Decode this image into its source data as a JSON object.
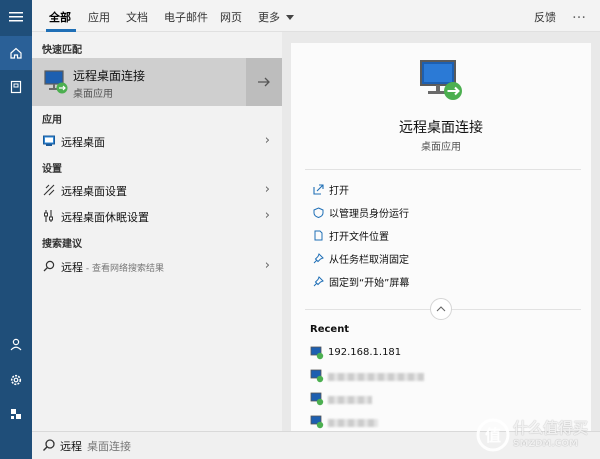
{
  "tabs": [
    "全部",
    "应用",
    "文档",
    "电子邮件",
    "网页",
    "更多"
  ],
  "topbar": {
    "feedback": "反馈",
    "more_icon_label": "…"
  },
  "left": {
    "best_match_section": "快速匹配",
    "best_match": {
      "title": "远程桌面连接",
      "subtitle": "桌面应用"
    },
    "apps_section": "应用",
    "apps": [
      {
        "label": "远程桌面"
      }
    ],
    "settings_section": "设置",
    "settings": [
      {
        "label": "远程桌面设置"
      },
      {
        "label": "远程桌面休眠设置"
      }
    ],
    "suggestions_section": "搜索建议",
    "suggestions": [
      {
        "label": "远程",
        "hint": " - 查看网络搜索结果"
      }
    ]
  },
  "details": {
    "title": "远程桌面连接",
    "subtitle": "桌面应用",
    "actions": [
      {
        "label": "打开",
        "icon": "open-icon"
      },
      {
        "label": "以管理员身份运行",
        "icon": "run-as-admin-icon"
      },
      {
        "label": "打开文件位置",
        "icon": "file-location-icon"
      },
      {
        "label": "从任务栏取消固定",
        "icon": "unpin-taskbar-icon"
      },
      {
        "label": "固定到“开始”屏幕",
        "icon": "pin-start-icon"
      }
    ],
    "recent_title": "Recent",
    "recent": [
      {
        "label": "192.168.1.181"
      },
      {
        "label": ""
      },
      {
        "label": ""
      },
      {
        "label": ""
      }
    ]
  },
  "search": {
    "typed": "远程",
    "ghost": "桌面连接"
  },
  "watermark": {
    "cn": "什么值得买",
    "en": "SMZDM.COM"
  },
  "colors": {
    "rail": "#1f4e79",
    "accent": "#1f6fb6"
  }
}
